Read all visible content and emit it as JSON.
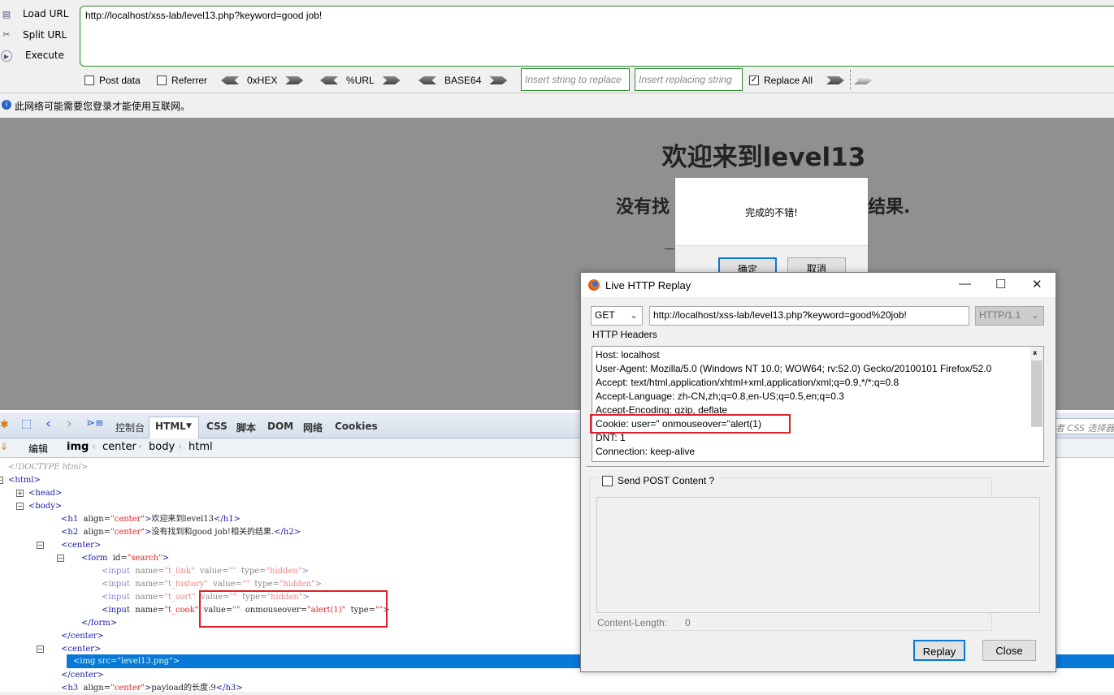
{
  "hackbar": {
    "load_url": "Load URL",
    "split_url": "Split URL",
    "execute": "Execute",
    "url_value": "http://localhost/xss-lab/level13.php?keyword=good job!",
    "post_data": "Post data",
    "referrer": "Referrer",
    "hex": "0xHEX",
    "url_enc": "%URL",
    "base64": "BASE64",
    "replace_placeholder": "Insert string to replace",
    "replacing_placeholder": "Insert replacing string",
    "replace_all": "Replace All",
    "replace_all_checked": true
  },
  "infobar": {
    "text": "此网络可能需要您登录才能使用互联网。"
  },
  "page": {
    "h1": "欢迎来到level13",
    "h2_left": "没有找",
    "h2_right": "结果.",
    "alert": {
      "message": "完成的不错!",
      "ok": "确定",
      "cancel": "取消"
    }
  },
  "devtools": {
    "tabs": [
      "控制台",
      "HTML",
      "CSS",
      "脚本",
      "DOM",
      "网络",
      "Cookies"
    ],
    "active_tab": "HTML",
    "edit": "编辑",
    "breadcrumbs": [
      "img",
      "center",
      "body",
      "html"
    ],
    "search_placeholder": "者 CSS 选择器",
    "tree": [
      {
        "indent": 0,
        "parts": [
          [
            "x",
            "<!DOCTYPE html>"
          ]
        ],
        "doctype": true
      },
      {
        "indent": 0,
        "toggle": "-",
        "parts": [
          [
            "k",
            "<html>"
          ]
        ]
      },
      {
        "indent": 1,
        "toggle": "+",
        "parts": [
          [
            "k",
            "<head>"
          ]
        ]
      },
      {
        "indent": 1,
        "toggle": "-",
        "parts": [
          [
            "k",
            "<body>"
          ]
        ]
      },
      {
        "indent": 2,
        "parts": [
          [
            "k",
            "<h1"
          ],
          [
            "a",
            "  align="
          ],
          [
            "v",
            "\"center\""
          ],
          [
            "k",
            ">"
          ],
          [
            "x",
            "欢迎来到level13"
          ],
          [
            "k",
            "</h1>"
          ]
        ]
      },
      {
        "indent": 2,
        "parts": [
          [
            "k",
            "<h2"
          ],
          [
            "a",
            "  align="
          ],
          [
            "v",
            "\"center\""
          ],
          [
            "k",
            ">"
          ],
          [
            "x",
            "没有找到和good job!相关的结果."
          ],
          [
            "k",
            "</h2>"
          ]
        ]
      },
      {
        "indent": 2,
        "toggle": "-",
        "parts": [
          [
            "k",
            "<center>"
          ]
        ]
      },
      {
        "indent": 3,
        "toggle": "-",
        "parts": [
          [
            "k",
            "<form"
          ],
          [
            "a",
            "  id="
          ],
          [
            "v",
            "\"search\""
          ],
          [
            "k",
            ">"
          ]
        ]
      },
      {
        "indent": 4,
        "dim": true,
        "parts": [
          [
            "k",
            "<input"
          ],
          [
            "a",
            "  name="
          ],
          [
            "v",
            "\"t_link\""
          ],
          [
            "a",
            "  value="
          ],
          [
            "v",
            "\"\""
          ],
          [
            "a",
            "  type="
          ],
          [
            "v",
            "\"hidden\""
          ],
          [
            "k",
            ">"
          ]
        ]
      },
      {
        "indent": 4,
        "dim": true,
        "parts": [
          [
            "k",
            "<input"
          ],
          [
            "a",
            "  name="
          ],
          [
            "v",
            "\"t_history\""
          ],
          [
            "a",
            "  value="
          ],
          [
            "v",
            "\"\""
          ],
          [
            "a",
            "  type="
          ],
          [
            "v",
            "\"hidden\""
          ],
          [
            "k",
            ">"
          ]
        ]
      },
      {
        "indent": 4,
        "dim": true,
        "parts": [
          [
            "k",
            "<input"
          ],
          [
            "a",
            "  name="
          ],
          [
            "v",
            "\"t_sort\""
          ],
          [
            "a",
            "  value="
          ],
          [
            "v",
            "\"\""
          ],
          [
            "a",
            "  type="
          ],
          [
            "v",
            "\"hidden\""
          ],
          [
            "k",
            ">"
          ]
        ]
      },
      {
        "indent": 4,
        "parts": [
          [
            "k",
            "<input"
          ],
          [
            "a",
            "  name="
          ],
          [
            "v",
            "\"t_cook\""
          ],
          [
            "a",
            "  value="
          ],
          [
            "v",
            "\"\""
          ],
          [
            "a",
            "  onmouseover="
          ],
          [
            "v",
            "\"alert(1)\""
          ],
          [
            "a",
            "  type="
          ],
          [
            "v",
            "\"\""
          ],
          [
            "k",
            ">"
          ]
        ]
      },
      {
        "indent": 3,
        "parts": [
          [
            "k",
            "</form>"
          ]
        ]
      },
      {
        "indent": 2,
        "parts": [
          [
            "k",
            "</center>"
          ]
        ]
      },
      {
        "indent": 2,
        "toggle": "-",
        "parts": [
          [
            "k",
            "<center>"
          ]
        ]
      },
      {
        "indent": 3,
        "selected": true,
        "parts": [
          [
            "k",
            "<img  src=\"level13.png\">"
          ]
        ]
      },
      {
        "indent": 2,
        "parts": [
          [
            "k",
            "</center>"
          ]
        ]
      },
      {
        "indent": 2,
        "parts": [
          [
            "k",
            "<h3"
          ],
          [
            "a",
            "  align="
          ],
          [
            "v",
            "\"center\""
          ],
          [
            "k",
            ">"
          ],
          [
            "x",
            "payload的长度:9"
          ],
          [
            "k",
            "</h3>"
          ]
        ]
      }
    ]
  },
  "replay": {
    "title": "Live HTTP Replay",
    "method": "GET",
    "url": "http://localhost/xss-lab/level13.php?keyword=good%20job!",
    "version": "HTTP/1.1",
    "headers_label": "HTTP Headers",
    "headers": [
      "Host: localhost",
      "User-Agent: Mozilla/5.0 (Windows NT 10.0; WOW64; rv:52.0) Gecko/20100101 Firefox/52.0",
      "Accept: text/html,application/xhtml+xml,application/xml;q=0.9,*/*;q=0.8",
      "Accept-Language: zh-CN,zh;q=0.8,en-US;q=0.5,en;q=0.3",
      "Accept-Encoding: gzip, deflate",
      "Cookie: user=\" onmouseover=\"alert(1)",
      "DNT: 1",
      "Connection: keep-alive"
    ],
    "send_post": "Send POST Content ?",
    "content_length_label": "Content-Length:",
    "content_length": "0",
    "replay_btn": "Replay",
    "close_btn": "Close"
  },
  "colors": {
    "highlight_box": "#e0202a",
    "selection": "#0a78d7",
    "hackbar_border": "#2e8b2e",
    "page_overlay": "#8f9091"
  }
}
